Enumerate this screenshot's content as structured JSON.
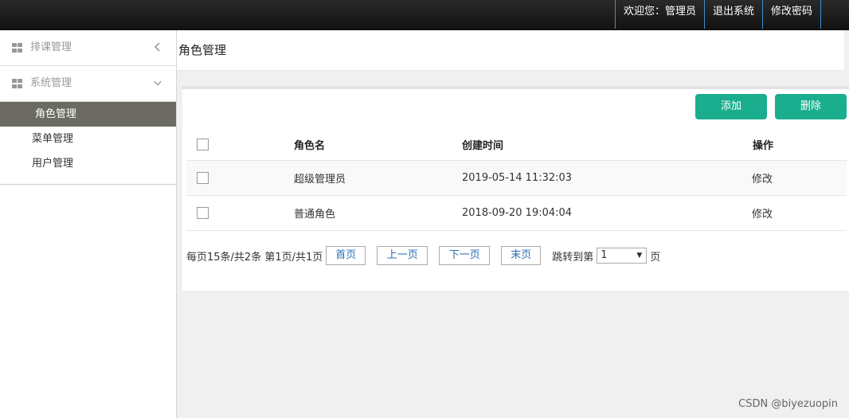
{
  "topnav": {
    "welcome": "欢迎您：管理员",
    "logout": "退出系统",
    "change_password": "修改密码"
  },
  "sidebar": {
    "groups": [
      {
        "label": "排课管理"
      },
      {
        "label": "系统管理"
      }
    ],
    "items": [
      {
        "label": "角色管理",
        "active": true
      },
      {
        "label": "菜单管理"
      },
      {
        "label": "用户管理"
      }
    ]
  },
  "page": {
    "title": "角色管理"
  },
  "toolbar": {
    "add_label": "添加",
    "delete_label": "删除"
  },
  "table": {
    "headers": [
      "角色名",
      "创建时间",
      "操作"
    ],
    "rows": [
      {
        "name": "超级管理员",
        "created": "2019-05-14 11:32:03",
        "action": "修改"
      },
      {
        "name": "普通角色",
        "created": "2018-09-20 19:04:04",
        "action": "修改"
      }
    ]
  },
  "pager": {
    "summary": "每页15条/共2条 第1页/共1页",
    "first": "首页",
    "prev": "上一页",
    "next": "下一页",
    "last": "末页",
    "jump_label": "跳转到第",
    "page_value": "1",
    "page_suffix": "页"
  },
  "watermark": "CSDN @biyezuopin",
  "colors": {
    "accent": "#1aae8e",
    "active_menu": "#6b6b63",
    "topbar": "#1a1a1a"
  }
}
